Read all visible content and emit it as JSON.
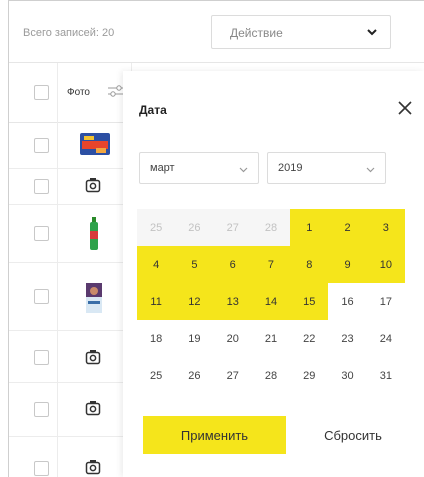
{
  "toolbar": {
    "total_label": "Всего записей: 20",
    "action_label": "Действие",
    "action_icon": "chevron-down-icon"
  },
  "table": {
    "photo_header": "Фото",
    "filter_icon": "sliders-icon",
    "rows": [
      {
        "thumb": "product-image-snack"
      },
      {
        "thumb": "camera-icon"
      },
      {
        "thumb": "product-image-bottle"
      },
      {
        "thumb": "product-image-package"
      },
      {
        "thumb": "camera-icon"
      },
      {
        "thumb": "camera-icon"
      },
      {
        "thumb": "camera-icon"
      }
    ]
  },
  "date_panel": {
    "title": "Дата",
    "close_icon": "close-icon",
    "month_value": "март",
    "year_value": "2019",
    "accent_color": "#f5e51b",
    "weeks": [
      [
        {
          "d": "25",
          "s": "muted"
        },
        {
          "d": "26",
          "s": "muted"
        },
        {
          "d": "27",
          "s": "muted"
        },
        {
          "d": "28",
          "s": "muted"
        },
        {
          "d": "1",
          "s": "sel"
        },
        {
          "d": "2",
          "s": "sel"
        },
        {
          "d": "3",
          "s": "sel"
        }
      ],
      [
        {
          "d": "4",
          "s": "sel"
        },
        {
          "d": "5",
          "s": "sel"
        },
        {
          "d": "6",
          "s": "sel"
        },
        {
          "d": "7",
          "s": "sel"
        },
        {
          "d": "8",
          "s": "sel"
        },
        {
          "d": "9",
          "s": "sel"
        },
        {
          "d": "10",
          "s": "sel"
        }
      ],
      [
        {
          "d": "11",
          "s": "sel"
        },
        {
          "d": "12",
          "s": "sel"
        },
        {
          "d": "13",
          "s": "sel"
        },
        {
          "d": "14",
          "s": "sel"
        },
        {
          "d": "15",
          "s": "sel"
        },
        {
          "d": "16",
          "s": ""
        },
        {
          "d": "17",
          "s": ""
        }
      ],
      [
        {
          "d": "18",
          "s": ""
        },
        {
          "d": "19",
          "s": ""
        },
        {
          "d": "20",
          "s": ""
        },
        {
          "d": "21",
          "s": ""
        },
        {
          "d": "22",
          "s": ""
        },
        {
          "d": "23",
          "s": ""
        },
        {
          "d": "24",
          "s": ""
        }
      ],
      [
        {
          "d": "25",
          "s": ""
        },
        {
          "d": "26",
          "s": ""
        },
        {
          "d": "27",
          "s": ""
        },
        {
          "d": "28",
          "s": ""
        },
        {
          "d": "29",
          "s": ""
        },
        {
          "d": "30",
          "s": ""
        },
        {
          "d": "31",
          "s": ""
        }
      ]
    ],
    "apply_label": "Применить",
    "reset_label": "Сбросить"
  }
}
